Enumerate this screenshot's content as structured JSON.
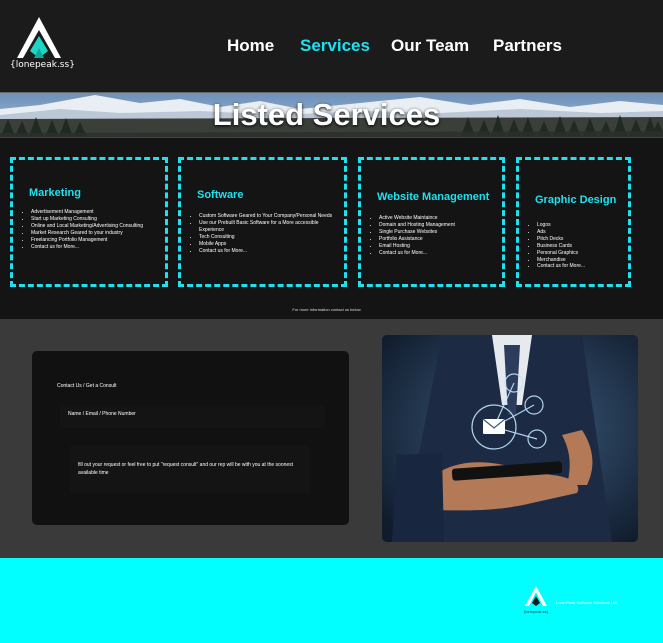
{
  "brand": {
    "name": "{lonepeak.ss}"
  },
  "nav": {
    "items": [
      {
        "label": "Home",
        "active": false
      },
      {
        "label": "Services",
        "active": true
      },
      {
        "label": "Our Team",
        "active": false
      },
      {
        "label": "Partners",
        "active": false
      }
    ]
  },
  "banner": {
    "title": "Listed Services"
  },
  "services": [
    {
      "title": "Marketing",
      "items": [
        "Advertisement Management",
        "Start up Marketing Consulting",
        "Online and Local Marketing/Advertising Consulting",
        "Market Research Geared to your industry",
        "Freelancing Portfolio Management",
        "Contact us for More..."
      ]
    },
    {
      "title": "Software",
      "items": [
        "Custom Software Geared to Your Company/Personal Needs",
        "Use our Prebuilt Basic Software for a More accessible Experience",
        "Tech Consulting",
        "Mobile Apps",
        "Contact us for More..."
      ]
    },
    {
      "title": "Website Management",
      "items": [
        "Active Website Maintaince",
        "Domain and Hosting Management",
        "Single Purchase Websites",
        "Portfolio Assistance",
        "Email Hosting",
        "Contact us for More..."
      ]
    },
    {
      "title": "Graphic Design",
      "items": [
        "Logos",
        "Ads",
        "Pitch Decks",
        "Business Cards",
        "Personal Graphics",
        "Merchandise",
        "Contact us for More..."
      ]
    }
  ],
  "more_info": "For more Information contact us below",
  "contact": {
    "title": "Contact Us / Get a Consult",
    "field_placeholder": "Name / Email / Phone Number",
    "message_placeholder": "fill out your request or feel free to put \"request consult\" and our rep will be with you at the soonest available time"
  },
  "footer": {
    "company": "Lone-Peak Software Solutions Ltd.",
    "logo_text": "{lonepeak.ss}"
  },
  "colors": {
    "accent": "#1fe0ef",
    "footer_bg": "#01ffff",
    "page_bg": "#1b1b1b",
    "panel_bg": "#111111"
  }
}
